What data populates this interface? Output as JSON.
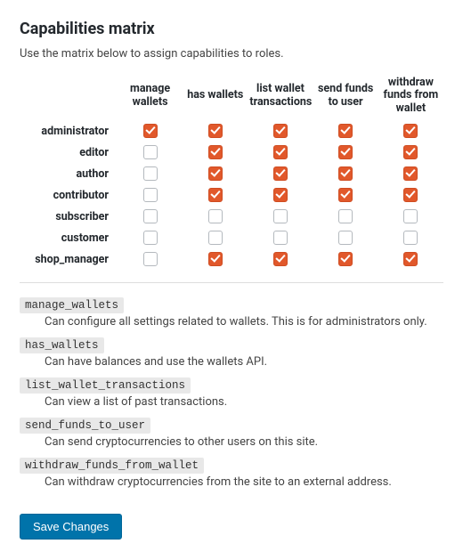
{
  "heading": "Capabilities matrix",
  "intro": "Use the matrix below to assign capabilities to roles.",
  "capabilities": [
    {
      "key": "manage_wallets",
      "label": "manage wallets",
      "desc": "Can configure all settings related to wallets. This is for administrators only."
    },
    {
      "key": "has_wallets",
      "label": "has wallets",
      "desc": "Can have balances and use the wallets API."
    },
    {
      "key": "list_wallet_transactions",
      "label": "list wallet transactions",
      "desc": "Can view a list of past transactions."
    },
    {
      "key": "send_funds_to_user",
      "label": "send funds to user",
      "desc": "Can send cryptocurrencies to other users on this site."
    },
    {
      "key": "withdraw_funds_from_wallet",
      "label": "withdraw funds from wallet",
      "desc": "Can withdraw cryptocurrencies from the site to an external address."
    }
  ],
  "roles": [
    {
      "key": "administrator",
      "label": "administrator",
      "caps": [
        true,
        true,
        true,
        true,
        true
      ]
    },
    {
      "key": "editor",
      "label": "editor",
      "caps": [
        false,
        true,
        true,
        true,
        true
      ]
    },
    {
      "key": "author",
      "label": "author",
      "caps": [
        false,
        true,
        true,
        true,
        true
      ]
    },
    {
      "key": "contributor",
      "label": "contributor",
      "caps": [
        false,
        true,
        true,
        true,
        true
      ]
    },
    {
      "key": "subscriber",
      "label": "subscriber",
      "caps": [
        false,
        false,
        false,
        false,
        false
      ]
    },
    {
      "key": "customer",
      "label": "customer",
      "caps": [
        false,
        false,
        false,
        false,
        false
      ]
    },
    {
      "key": "shop_manager",
      "label": "shop_manager",
      "caps": [
        false,
        true,
        true,
        true,
        true
      ]
    }
  ],
  "save_label": "Save Changes"
}
